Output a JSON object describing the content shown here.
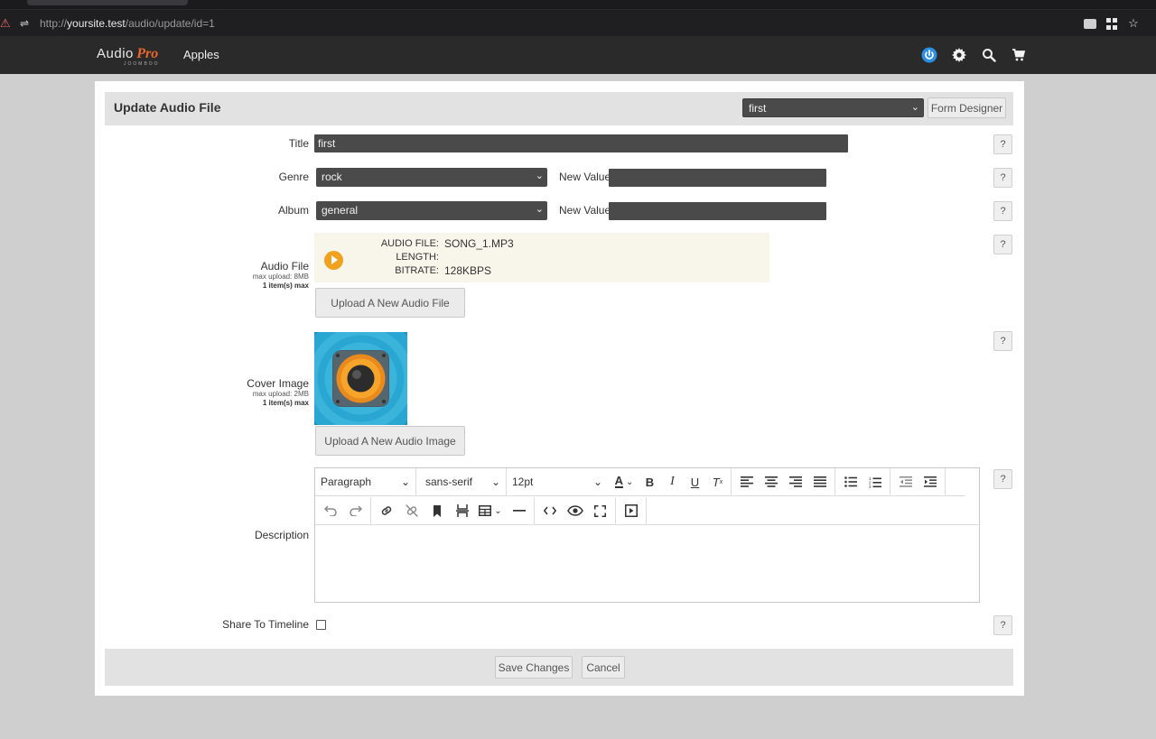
{
  "browser": {
    "url_prefix": "http://",
    "url_host": "yoursite.test",
    "url_path": "/audio/update/id=1"
  },
  "navbar": {
    "logo_part1": "Audio",
    "logo_part2": "Pro",
    "logo_sub": "JOOMBOO",
    "menu_item": "Apples",
    "icons": [
      "power-icon",
      "gear-icon",
      "search-icon",
      "cart-icon"
    ]
  },
  "header": {
    "title": "Update Audio File",
    "form_select_value": "first",
    "form_designer_label": "Form Designer"
  },
  "fields": {
    "title": {
      "label": "Title",
      "value": "first"
    },
    "genre": {
      "label": "Genre",
      "value": "rock",
      "new_value_label": "New Value",
      "new_value": ""
    },
    "album": {
      "label": "Album",
      "value": "general",
      "new_value_label": "New Value",
      "new_value": ""
    },
    "audio_file": {
      "label": "Audio File",
      "hint_upload": "max upload: 8MB",
      "hint_items": "1 item(s) max",
      "meta_file_key": "AUDIO FILE:",
      "meta_file_val": "SONG_1.MP3",
      "meta_length_key": "LENGTH:",
      "meta_length_val": "",
      "meta_bitrate_key": "BITRATE:",
      "meta_bitrate_val": "128KBPS",
      "upload_label": "Upload A New Audio File"
    },
    "cover_image": {
      "label": "Cover Image",
      "hint_upload": "max upload: 2MB",
      "hint_items": "1 item(s) max",
      "upload_label": "Upload A New Audio Image"
    },
    "description": {
      "label": "Description",
      "block_format": "Paragraph",
      "font_family": "sans-serif",
      "font_size": "12pt"
    },
    "share": {
      "label": "Share To Timeline",
      "checked": false
    }
  },
  "help_label": "?",
  "footer": {
    "save_label": "Save Changes",
    "cancel_label": "Cancel"
  },
  "colors": {
    "accent_orange": "#e8672a",
    "play_button": "#f0a21e",
    "power_blue": "#2c8fe3",
    "input_dark": "#4a4a4a"
  }
}
